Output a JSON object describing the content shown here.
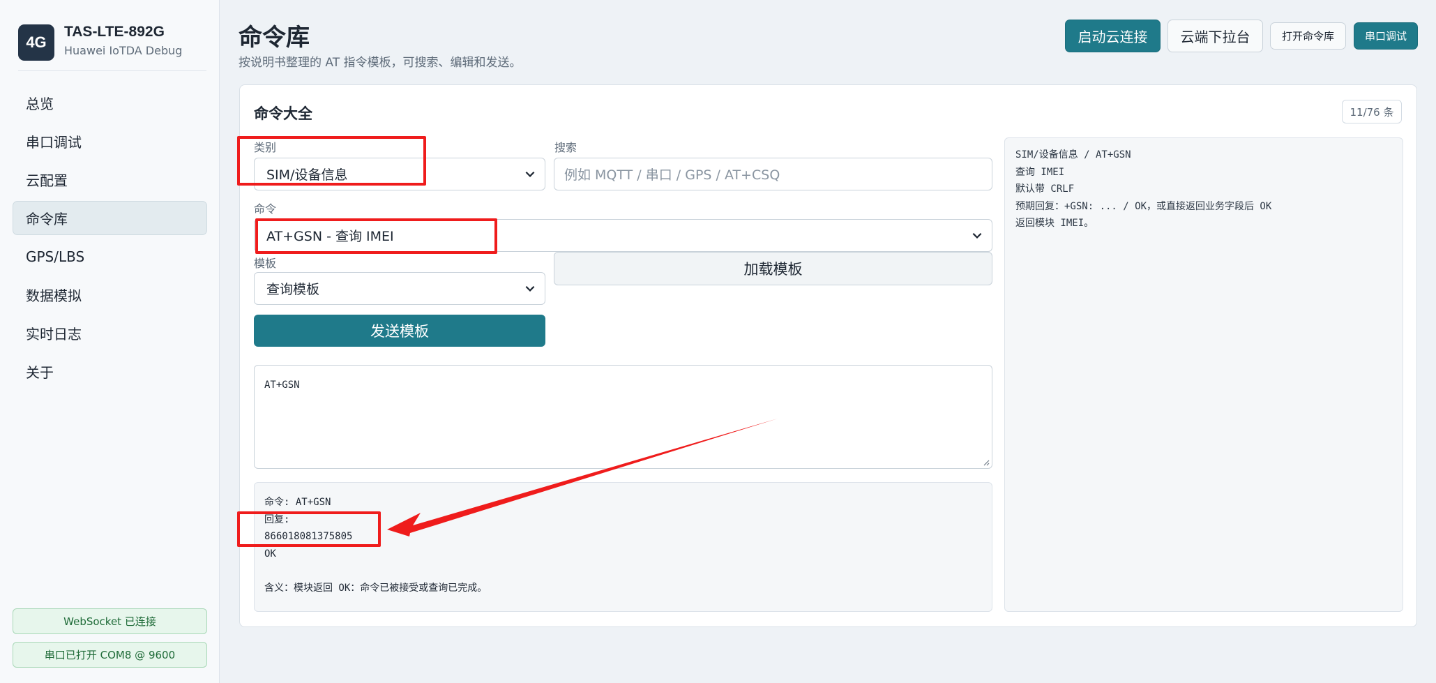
{
  "brand": {
    "logo_text": "4G",
    "title": "TAS-LTE-892G",
    "subtitle": "Huawei IoTDA Debug"
  },
  "nav": {
    "items": [
      {
        "label": "总览"
      },
      {
        "label": "串口调试"
      },
      {
        "label": "云配置"
      },
      {
        "label": "命令库"
      },
      {
        "label": "GPS/LBS"
      },
      {
        "label": "数据模拟"
      },
      {
        "label": "实时日志"
      },
      {
        "label": "关于"
      }
    ],
    "active": "命令库"
  },
  "status": {
    "websocket": "WebSocket 已连接",
    "serial": "串口已打开 COM8 @ 9600"
  },
  "header": {
    "title": "命令库",
    "description": "按说明书整理的 AT 指令模板，可搜索、编辑和发送。",
    "buttons": {
      "start_cloud": "启动云连接",
      "cloud_downlink": "云端下拉台",
      "open_library": "打开命令库",
      "serial_debug": "串口调试"
    }
  },
  "card": {
    "title": "命令大全",
    "count": "11/76 条",
    "category_label": "类别",
    "category_value": "SIM/设备信息",
    "search_label": "搜索",
    "search_placeholder": "例如 MQTT / 串口 / GPS / AT+CSQ",
    "command_label": "命令",
    "command_value": "AT+GSN - 查询 IMEI",
    "template_label": "模板",
    "template_value": "查询模板",
    "load_button": "加载模板",
    "send_button": "发送模板",
    "editor_text": "AT+GSN",
    "response_lines": [
      "命令: AT+GSN",
      "回复:",
      "866018081375805",
      "OK",
      "",
      "含义：模块返回 OK：命令已被接受或查询已完成。"
    ],
    "info_lines": [
      "SIM/设备信息 / AT+GSN",
      "查询 IMEI",
      "默认带 CRLF",
      "预期回复：+GSN: ... / OK，或直接返回业务字段后 OK",
      "返回模块 IMEI。"
    ]
  },
  "colors": {
    "accent": "#1f7a8a",
    "annotation_red": "#ef1c1c",
    "status_green": "#1f6b38"
  }
}
